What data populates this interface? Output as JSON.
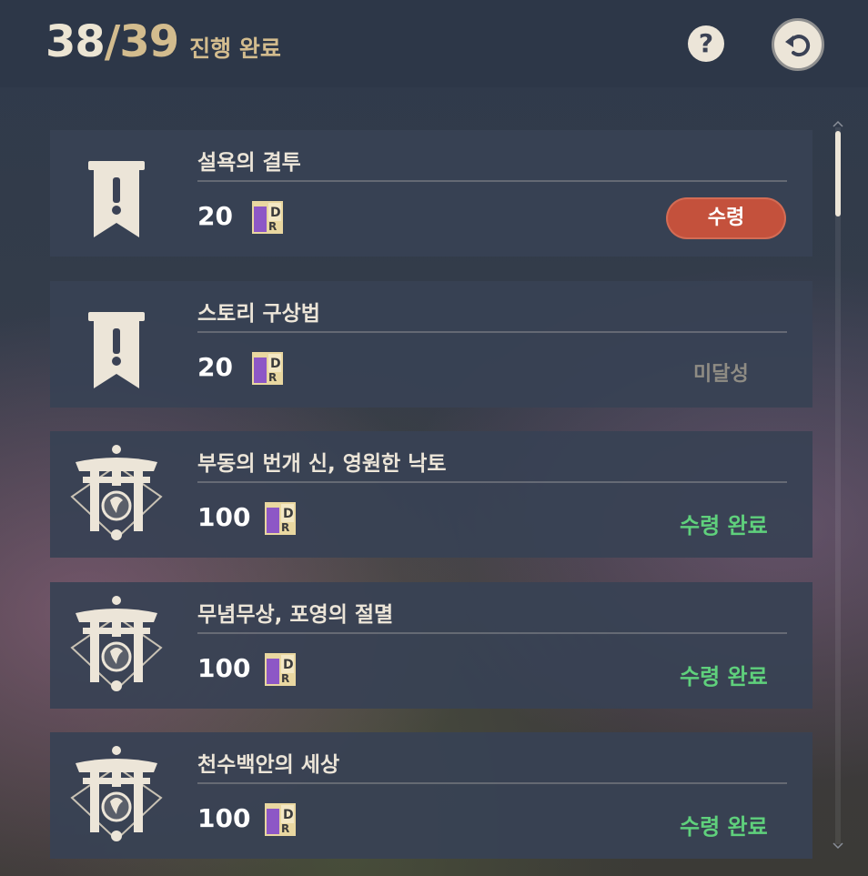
{
  "header": {
    "progress_current": "38",
    "progress_separator": "/",
    "progress_total": "39",
    "progress_label": "진행 완료",
    "help_label": "?"
  },
  "icons": {
    "help": "question-icon",
    "back": "back-arrow-icon",
    "quest": "quest-banner-icon",
    "inazuma": "inazuma-torii-icon",
    "reward": "primogem-icon"
  },
  "colors": {
    "claim_button": "#c4513c",
    "completed_text": "#5fd07c",
    "locked_text": "#8f8c84",
    "gold_accent": "#d3bc8e"
  },
  "achievements": [
    {
      "title": "설욕의 결투",
      "reward": "20",
      "status": "수령"
    },
    {
      "title": "스토리 구상법",
      "reward": "20",
      "status": "미달성"
    },
    {
      "title": "부동의 번개 신, 영원한 낙토",
      "reward": "100",
      "status": "수령 완료"
    },
    {
      "title": "무념무상, 포영의 절멸",
      "reward": "100",
      "status": "수령 완료"
    },
    {
      "title": "천수백안의 세상",
      "reward": "100",
      "status": "수령 완료"
    }
  ]
}
